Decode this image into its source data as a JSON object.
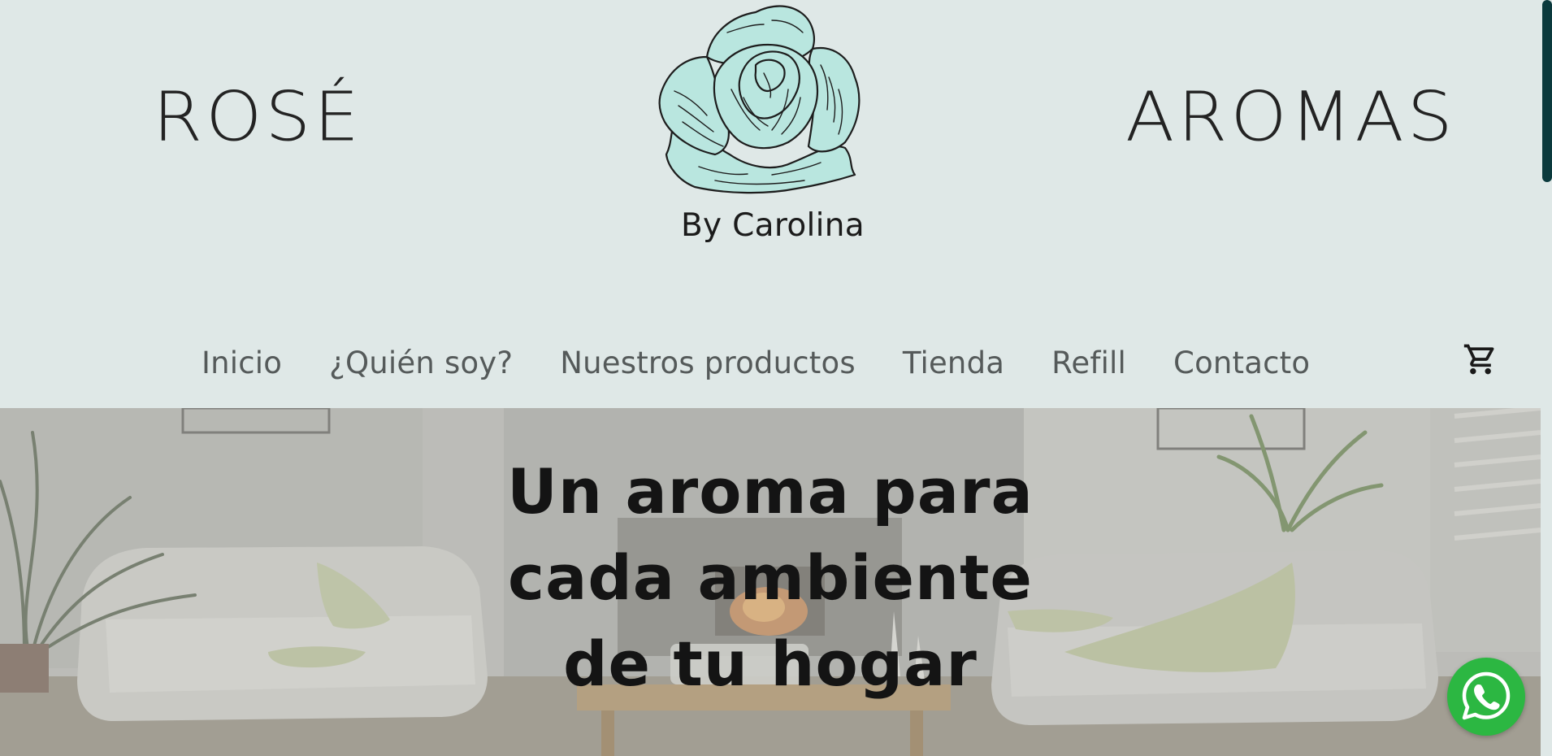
{
  "brand": {
    "left_word": "ROSÉ",
    "right_word": "AROMAS",
    "byline": "By Carolina",
    "logo_icon": "rose-icon"
  },
  "nav": {
    "items": [
      {
        "label": "Inicio"
      },
      {
        "label": "¿Quién soy?"
      },
      {
        "label": "Nuestros productos"
      },
      {
        "label": "Tienda"
      },
      {
        "label": "Refill"
      },
      {
        "label": "Contacto"
      }
    ],
    "cart_icon": "shopping-cart-icon"
  },
  "hero": {
    "line1": "Un aroma para",
    "line2": "cada ambiente",
    "line3": "de tu hogar"
  },
  "floating": {
    "whatsapp_icon": "whatsapp-icon"
  },
  "colors": {
    "header_bg": "#dfe8e7",
    "scroll_thumb": "#0b3a3d",
    "whatsapp_green": "#2cb742",
    "rose_fill": "#b9e6df"
  }
}
